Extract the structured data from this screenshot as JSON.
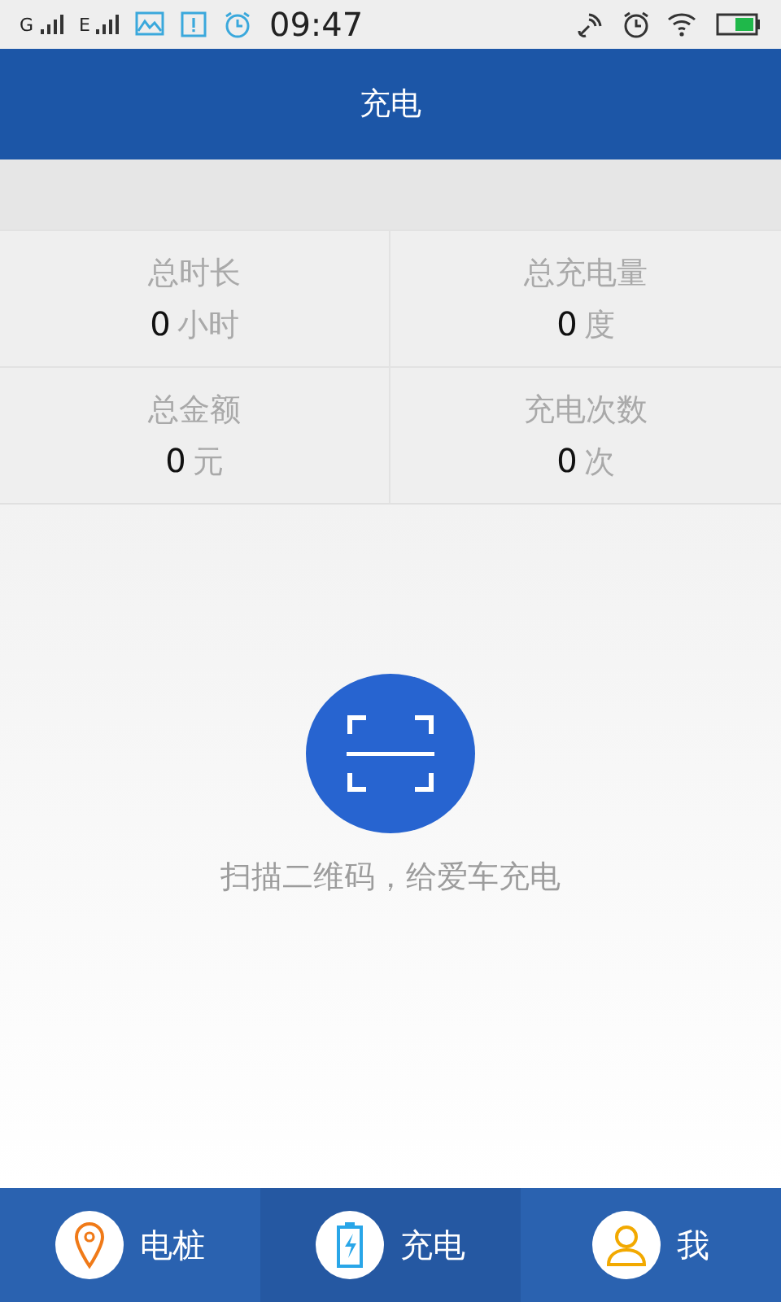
{
  "status_bar": {
    "sim_labels": [
      "G",
      "E"
    ],
    "time": "09:47"
  },
  "header": {
    "title": "充电"
  },
  "stats": [
    {
      "label": "总时长",
      "value": "0",
      "unit": "小时"
    },
    {
      "label": "总充电量",
      "value": "0",
      "unit": "度"
    },
    {
      "label": "总金额",
      "value": "0",
      "unit": "元"
    },
    {
      "label": "充电次数",
      "value": "0",
      "unit": "次"
    }
  ],
  "scan": {
    "caption": "扫描二维码，给爱车充电"
  },
  "tabs": [
    {
      "label": "电桩",
      "kind": "pin",
      "selected": false
    },
    {
      "label": "充电",
      "kind": "battery",
      "selected": true
    },
    {
      "label": "我",
      "kind": "person",
      "selected": false
    }
  ]
}
